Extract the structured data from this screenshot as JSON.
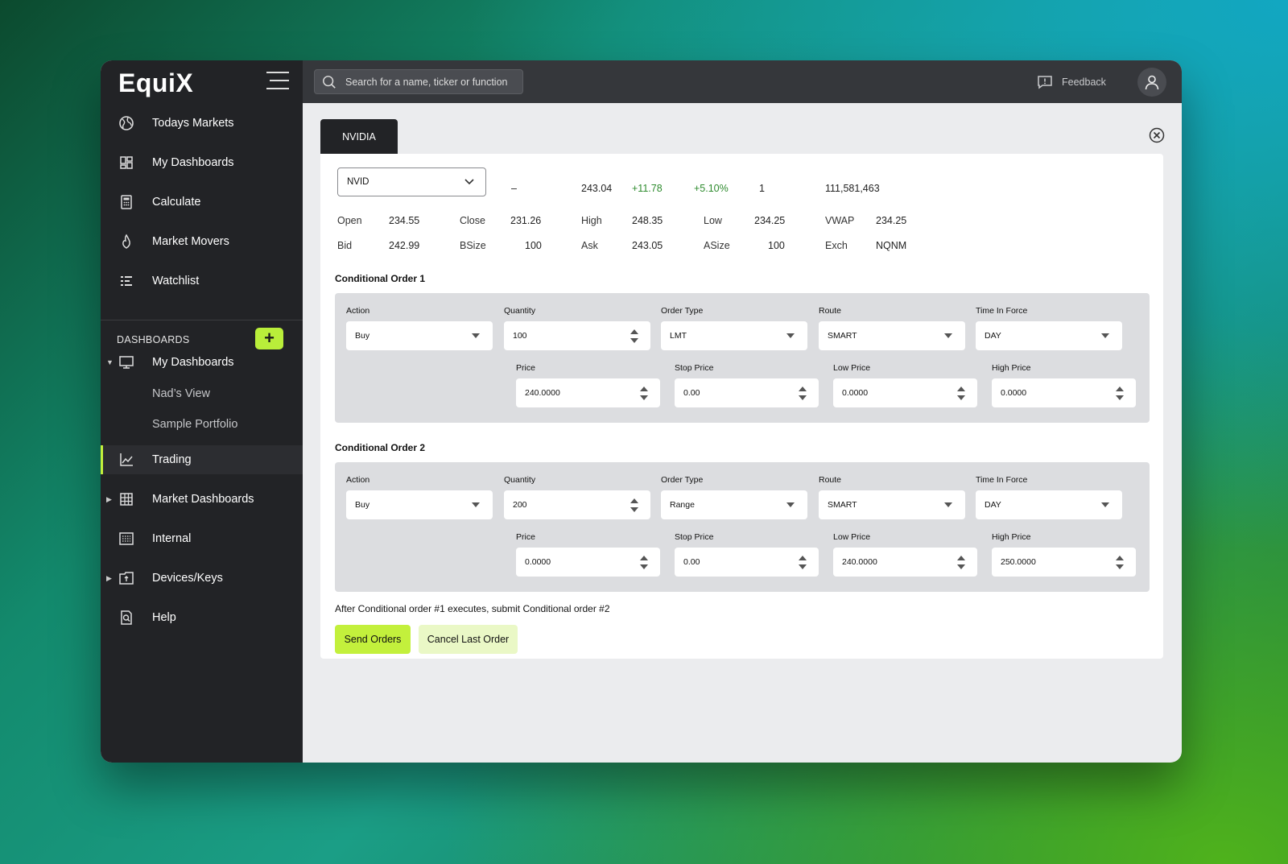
{
  "app": {
    "logo": "EquiX"
  },
  "sidebar": {
    "nav": [
      {
        "label": "Todays Markets",
        "icon": "globe-icon"
      },
      {
        "label": "My Dashboards",
        "icon": "dashboard-grid-icon"
      },
      {
        "label": "Calculate",
        "icon": "calculator-icon"
      },
      {
        "label": "Market Movers",
        "icon": "flame-icon"
      },
      {
        "label": "Watchlist",
        "icon": "list-icon"
      }
    ],
    "dashboards_header": "DASHBOARDS",
    "my_dashboards": "My Dashboards",
    "sub_items": [
      "Nad’s View",
      "Sample Portfolio"
    ],
    "trading": "Trading",
    "market_dashboards": "Market Dashboards",
    "internal": "Internal",
    "devices": "Devices/Keys",
    "help": "Help"
  },
  "topbar": {
    "search_placeholder": "Search for a name, ticker or function",
    "feedback": "Feedback"
  },
  "tab": {
    "label": "NVIDIA"
  },
  "quote": {
    "symbol": "NVID",
    "dash": "–",
    "last": "243.04",
    "change": "+11.78",
    "change_pct": "+5.10%",
    "size": "1",
    "volume": "111,581,463",
    "open_label": "Open",
    "open": "234.55",
    "close_label": "Close",
    "close": "231.26",
    "high_label": "High",
    "high": "248.35",
    "low_label": "Low",
    "low": "234.25",
    "vwap_label": "VWAP",
    "vwap": "234.25",
    "bid_label": "Bid",
    "bid": "242.99",
    "bsize_label": "BSize",
    "bsize": "100",
    "ask_label": "Ask",
    "ask": "243.05",
    "asize_label": "ASize",
    "asize": "100",
    "exch_label": "Exch",
    "exch": "NQNM"
  },
  "labels": {
    "action": "Action",
    "quantity": "Quantity",
    "order_type": "Order Type",
    "route": "Route",
    "tif": "Time In Force",
    "price": "Price",
    "stop_price": "Stop Price",
    "low_price": "Low Price",
    "high_price": "High Price"
  },
  "orders": [
    {
      "title": "Conditional Order 1",
      "action": "Buy",
      "quantity": "100",
      "order_type": "LMT",
      "route": "SMART",
      "tif": "DAY",
      "price": "240.0000",
      "stop_price": "0.00",
      "low_price": "0.0000",
      "high_price": "0.0000"
    },
    {
      "title": "Conditional Order 2",
      "action": "Buy",
      "quantity": "200",
      "order_type": "Range",
      "route": "SMART",
      "tif": "DAY",
      "price": "0.0000",
      "stop_price": "0.00",
      "low_price": "240.0000",
      "high_price": "250.0000"
    }
  ],
  "note": "After Conditional order #1 executes, submit Conditional order #2",
  "buttons": {
    "send": "Send Orders",
    "cancel": "Cancel Last Order"
  },
  "colors": {
    "accent": "#c3f03c",
    "sidebar": "#222326",
    "positive": "#2e8b2e"
  }
}
